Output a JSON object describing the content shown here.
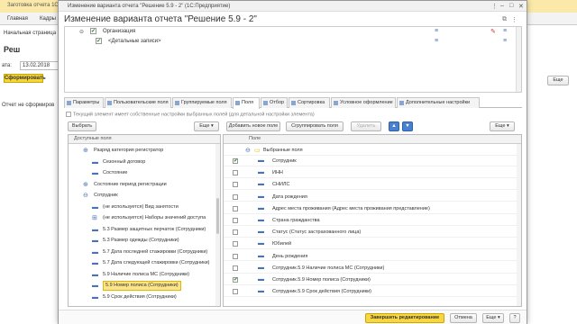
{
  "bg": {
    "top_title": "Заготовка отчета 1С:Предприятие",
    "nav": [
      "Главная",
      "Кадры"
    ],
    "start_tab": "Начальная страница",
    "report_title": "Реш",
    "date_label": "ата:",
    "date_value": "13.02.2018",
    "form_button": "Сформировать",
    "not_formed": "Отчет не сформиров",
    "more_button": "Еще"
  },
  "window": {
    "title": "Изменение варианта отчета \"Решение 5.9 - 2\" (1С:Предприятие)",
    "heading": "Изменение варианта отчета \"Решение 5.9 - 2\"",
    "controls": {
      "menu": "⋮",
      "minimize": "–",
      "maximize": "□",
      "close": "✕"
    }
  },
  "top_table": {
    "rows": [
      {
        "label": "Организация",
        "checked": true
      },
      {
        "label": "<Детальные записи>",
        "checked": true
      }
    ]
  },
  "tabs": [
    "Параметры",
    "Пользовательские поля",
    "Группируемые поля",
    "Поля",
    "Отбор",
    "Сортировка",
    "Условное оформление",
    "Дополнительные настройки"
  ],
  "current_check": "Текущий элемент имеет собственные настройки выбранных полей (для детальной настройки элемента)",
  "left_toolbar": {
    "select": "Выбрать",
    "more": "Еще ▾"
  },
  "right_toolbar": {
    "add_field": "Добавить новое поле",
    "group_fields": "Сгруппировать поля",
    "delete": "Удалить",
    "up": "▲",
    "down": "▼",
    "more": "Еще ▾"
  },
  "available": {
    "header": "Доступные поля",
    "items": [
      {
        "label": "Разряд категория регистратор",
        "mark": "⊕",
        "indent": 1
      },
      {
        "label": "Сезонный договор",
        "mark": "▬",
        "indent": 2
      },
      {
        "label": "Состояние",
        "mark": "▬",
        "indent": 2
      },
      {
        "label": "Состояние период регистрации",
        "mark": "⊕",
        "indent": 1
      },
      {
        "label": "Сотрудник",
        "mark": "⊖",
        "indent": 1
      },
      {
        "label": "(не используется) Вид занятости",
        "mark": "▬",
        "indent": 2
      },
      {
        "label": "(не используется) Наборы значений доступа",
        "mark": "⊞",
        "indent": 2
      },
      {
        "label": "5.3 Размер защитных перчаток (Сотрудники)",
        "mark": "▬",
        "indent": 2
      },
      {
        "label": "5.3 Размер одежды (Сотрудники)",
        "mark": "▬",
        "indent": 2
      },
      {
        "label": "5.7 Дата последней стажировки (Сотрудники)",
        "mark": "▬",
        "indent": 2
      },
      {
        "label": "5.7 Дата следующей стажировки (Сотрудники)",
        "mark": "▬",
        "indent": 2
      },
      {
        "label": "5.9 Наличие полиса МС (Сотрудники)",
        "mark": "▬",
        "indent": 2
      },
      {
        "label": "5.9 Номер полиса (Сотрудники)",
        "mark": "▬",
        "indent": 2,
        "selected": true
      },
      {
        "label": "5.9 Срок действия (Сотрудники)",
        "mark": "▬",
        "indent": 2
      }
    ]
  },
  "fields": {
    "header": "Поле",
    "group_label": "Выбранные поля",
    "items": [
      {
        "label": "Сотрудник",
        "checked": true
      },
      {
        "label": "ИНН",
        "checked": false
      },
      {
        "label": "СНИЛС",
        "checked": false
      },
      {
        "label": "Дата рождения",
        "checked": false
      },
      {
        "label": "Адрес места проживания (Адрес места проживания представление)",
        "checked": false
      },
      {
        "label": "Страна гражданства",
        "checked": false
      },
      {
        "label": "Статус (Статус застрахованного лица)",
        "checked": false
      },
      {
        "label": "Юбилей",
        "checked": false
      },
      {
        "label": "День рождения",
        "checked": false
      },
      {
        "label": "Сотрудник.5.9 Наличие полиса МС (Сотрудники)",
        "checked": false
      },
      {
        "label": "Сотрудник.5.9 Номер полиса (Сотрудники)",
        "checked": true
      },
      {
        "label": "Сотрудник.5.9 Срок действия (Сотрудники)",
        "checked": false
      }
    ]
  },
  "footer": {
    "finish": "Завершить редактирование",
    "cancel": "Отмена",
    "more": "Еще ▾",
    "help": "?"
  }
}
